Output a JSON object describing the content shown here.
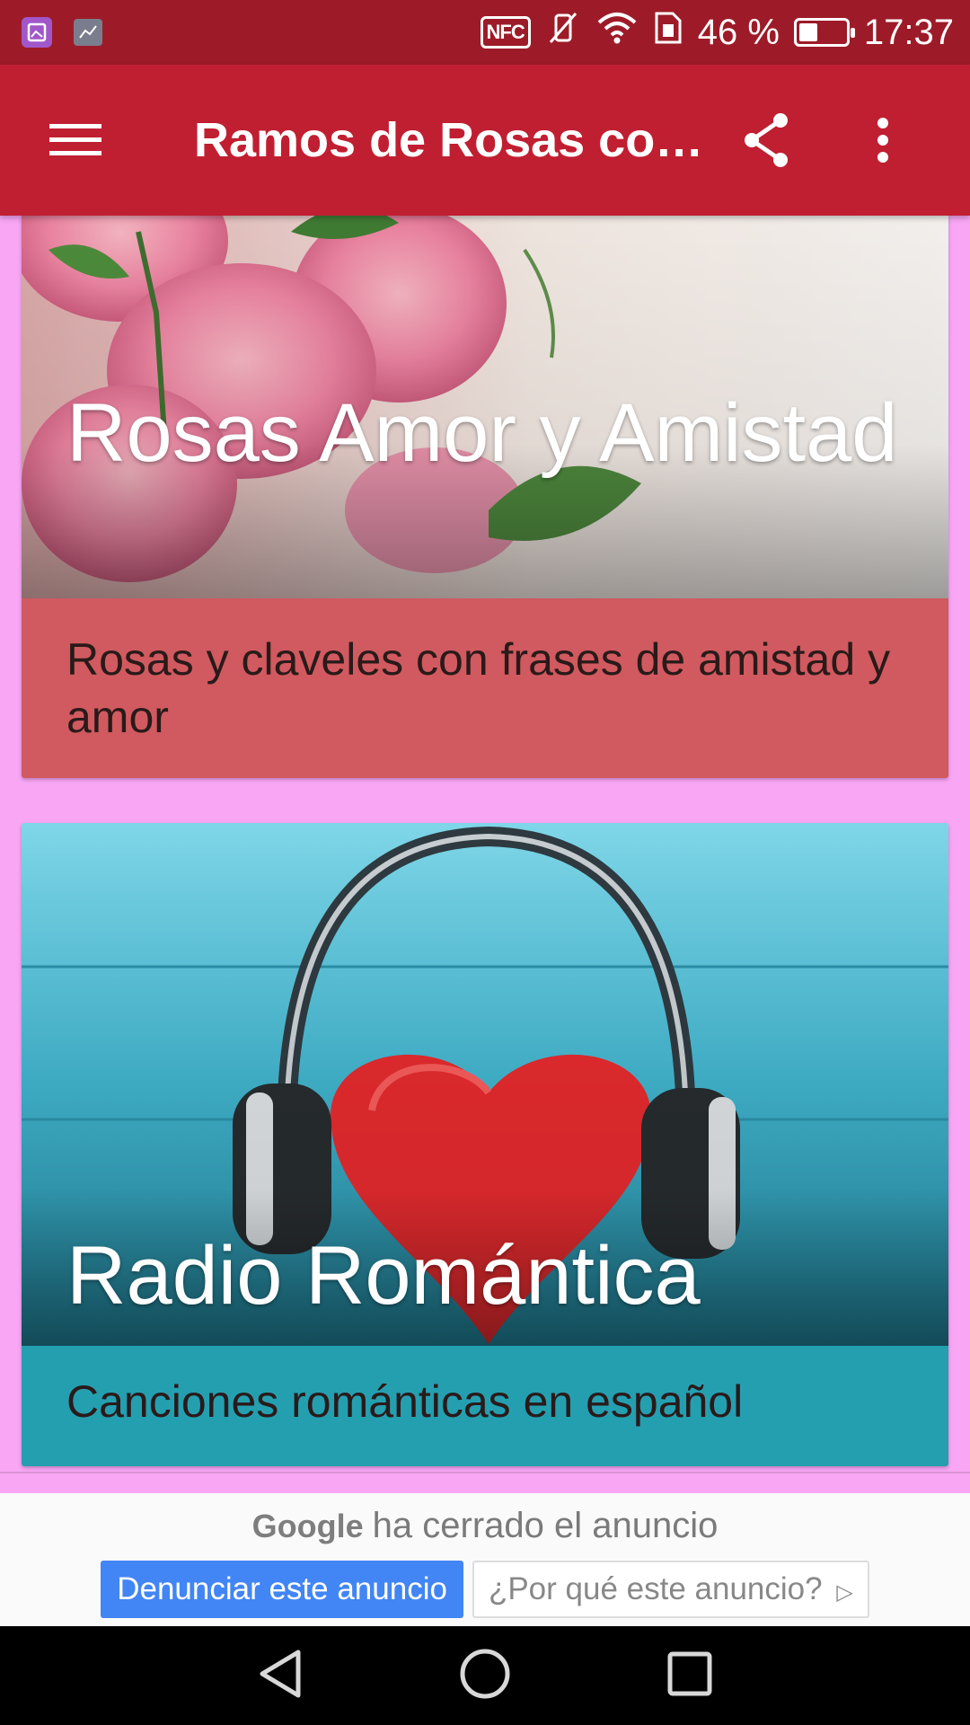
{
  "status_bar": {
    "battery_percent_label": "46 %",
    "battery_level": 0.46,
    "time": "17:37",
    "nfc_label": "NFC",
    "icons": [
      "gallery-icon",
      "chart-icon",
      "nfc-icon",
      "vibrate-off-icon",
      "wifi-icon",
      "sim-icon",
      "battery-icon"
    ]
  },
  "app_bar": {
    "title": "Ramos de Rosas co…",
    "icons": [
      "hamburger-menu-icon",
      "share-icon",
      "overflow-menu-icon"
    ]
  },
  "cards": [
    {
      "title": "Rosas Amor y Amistad",
      "description": "Rosas y claveles con frases de amistad y amor",
      "description_bg": "#d05a5f",
      "image": "pink-roses-image"
    },
    {
      "title": "Radio Romántica",
      "description": "Canciones románticas en español",
      "description_bg": "#249fb0",
      "image": "heart-headphones-image"
    }
  ],
  "ad": {
    "brand": "Google",
    "message": "ha cerrado el anuncio",
    "report_button": "Denunciar este anuncio",
    "why_button": "¿Por qué este anuncio?"
  },
  "nav_bar": {
    "icons": [
      "back-icon",
      "home-icon",
      "recents-icon"
    ]
  },
  "colors": {
    "status_bar": "#9d1b28",
    "app_bar": "#c01f31",
    "background": "#f9a7f5"
  }
}
